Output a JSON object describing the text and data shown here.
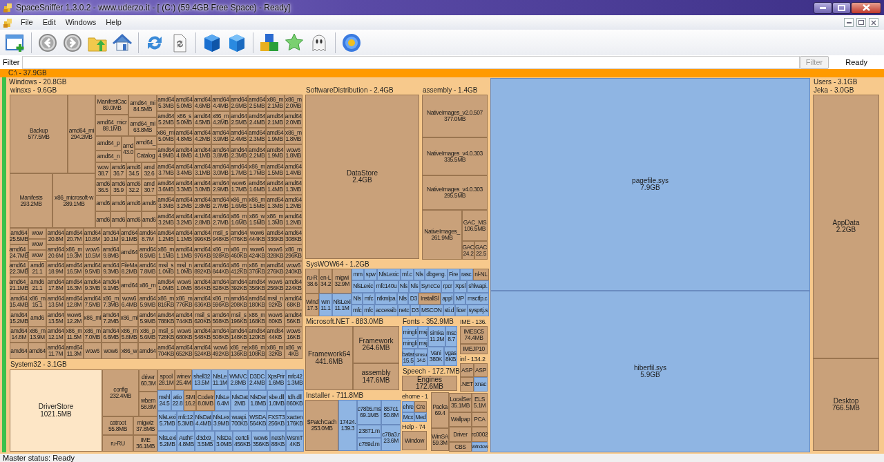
{
  "window": {
    "title": "SpaceSniffer 1.3.0.2 - www.uderzo.it - [ (C:) (59.4GB Free Space) - Ready]"
  },
  "menu": [
    "File",
    "Edit",
    "Windows",
    "Help"
  ],
  "filter": {
    "label": "Filter",
    "button": {
      "label": "Filter",
      "disabled": true
    },
    "status": "Ready"
  },
  "treemap": {
    "drive": "C:\\ - 37.9GB",
    "windows": {
      "label": "Windows - 20.8GB",
      "winsxs": {
        "label": "winsxs - 9.6GB",
        "kind": "folder",
        "large": [
          {
            "name": "Backup",
            "size": "577.5MB"
          },
          {
            "name": "amd64_mi",
            "size": "294.2MB"
          },
          {
            "name": "Manifests",
            "size": "293.2MB"
          },
          {
            "name": "x86_microsoft-w",
            "size": "289.1MB"
          }
        ],
        "small": [
          {
            "name": "ManifestCac",
            "size": "89.0MB"
          },
          {
            "name": "amd64_mi",
            "size": "84.5MB"
          },
          {
            "name": "amd64_micr",
            "size": "88.1MB"
          },
          {
            "name": "amd64_mi",
            "size": "63.8MB"
          },
          {
            "name": "amd64_p"
          },
          {
            "name": "amd",
            "size": "43.0"
          },
          {
            "name": "amd64_"
          },
          {
            "name": "amd64_n"
          },
          {
            "name": "Catalog"
          }
        ],
        "mid": [
          {
            "name": "wow",
            "size": "38.7"
          },
          {
            "name": "amd6",
            "size": "36.7"
          },
          {
            "name": "amd6",
            "size": "34.5"
          },
          {
            "name": "amd",
            "size": "32.6"
          },
          {
            "name": "amd6",
            "size": "36.5"
          },
          {
            "name": "amd6",
            "size": "35.9"
          },
          {
            "name": "amd6",
            "size": "32.2"
          },
          {
            "name": "amd",
            "size": "30.7"
          },
          {
            "name": "amd6"
          },
          {
            "name": "amd6"
          },
          {
            "name": "amd6"
          },
          {
            "name": "amd6"
          },
          {
            "name": "amd6"
          },
          {
            "name": "amd6"
          },
          {
            "name": "amd6"
          },
          {
            "name": "amd6"
          }
        ],
        "grid_top": [
          {
            "name": "amd64",
            "size": "5.3MB"
          },
          {
            "name": "amd64",
            "size": "5.0MB"
          },
          {
            "name": "amd64",
            "size": "4.6MB"
          },
          {
            "name": "amd64",
            "size": "4.4MB"
          },
          {
            "name": "amd64",
            "size": "2.6MB"
          },
          {
            "name": "amd64",
            "size": "2.5MB"
          },
          {
            "name": "x86_m",
            "size": "2.1MB"
          },
          {
            "name": "x86_m",
            "size": "2.0MB"
          },
          {
            "name": "amd64",
            "size": "5.2MB"
          },
          {
            "name": "x86_s",
            "size": "5.0MB"
          },
          {
            "name": "amd64",
            "size": "4.5MB"
          },
          {
            "name": "x86_m",
            "size": "4.2MB"
          },
          {
            "name": "amd64",
            "size": "2.5MB"
          },
          {
            "name": "amd64",
            "size": "2.4MB"
          },
          {
            "name": "amd64",
            "size": "2.1MB"
          },
          {
            "name": "amd64",
            "size": "2.0MB"
          },
          {
            "name": "x86_mi",
            "size": "5.0MB"
          },
          {
            "name": "amd64",
            "size": "4.8MB"
          },
          {
            "name": "amd64",
            "size": "4.2MB"
          },
          {
            "name": "amd64",
            "size": "3.9MB"
          },
          {
            "name": "amd64",
            "size": "2.4MB"
          },
          {
            "name": "amd64",
            "size": "2.3MB"
          },
          {
            "name": "amd64",
            "size": "1.9MB"
          },
          {
            "name": "x86_m",
            "size": "1.8MB"
          },
          {
            "name": "amd64",
            "size": "4.9MB"
          },
          {
            "name": "amd64",
            "size": "4.8MB"
          },
          {
            "name": "amd64",
            "size": "4.1MB"
          },
          {
            "name": "amd64",
            "size": "3.8MB"
          },
          {
            "name": "amd64",
            "size": "2.3MB"
          },
          {
            "name": "amd64",
            "size": "2.2MB"
          },
          {
            "name": "amd64",
            "size": "1.9MB"
          },
          {
            "name": "wow6",
            "size": "1.8MB"
          },
          {
            "name": "amd64",
            "size": "3.7MB"
          },
          {
            "name": "amd64",
            "size": "3.4MB"
          },
          {
            "name": "amd64",
            "size": "3.1MB"
          },
          {
            "name": "amd64",
            "size": "3.0MB"
          },
          {
            "name": "amd64",
            "size": "1.7MB"
          },
          {
            "name": "x86_m",
            "size": "1.7MB"
          },
          {
            "name": "amd64",
            "size": "1.5MB"
          },
          {
            "name": "amd64",
            "size": "1.4MB"
          },
          {
            "name": "amd64",
            "size": "3.6MB"
          },
          {
            "name": "amd64",
            "size": "3.3MB"
          },
          {
            "name": "amd64",
            "size": "3.0MB"
          },
          {
            "name": "amd64",
            "size": "2.9MB"
          },
          {
            "name": "wow6",
            "size": "1.7MB"
          },
          {
            "name": "amd64",
            "size": "1.6MB"
          },
          {
            "name": "amd64",
            "size": "1.4MB"
          },
          {
            "name": "amd64",
            "size": "1.3MB"
          },
          {
            "name": "amd64",
            "size": "3.3MB"
          },
          {
            "name": "amd64",
            "size": "3.2MB"
          },
          {
            "name": "amd64",
            "size": "2.8MB"
          },
          {
            "name": "amd64",
            "size": "2.7MB"
          },
          {
            "name": "x86_m",
            "size": "1.6MB"
          },
          {
            "name": "x86_m",
            "size": "1.5MB"
          },
          {
            "name": "amd64",
            "size": "1.3MB"
          },
          {
            "name": "amd64",
            "size": "1.2MB"
          },
          {
            "name": "amd64",
            "size": "3.2MB"
          },
          {
            "name": "amd64",
            "size": "3.2MB"
          },
          {
            "name": "amd64",
            "size": "2.8MB"
          },
          {
            "name": "amd64",
            "size": "2.7MB"
          },
          {
            "name": "x86_m",
            "size": "1.6MB"
          },
          {
            "name": "x86_w",
            "size": "1.5MB"
          },
          {
            "name": "x86_m",
            "size": "1.3MB"
          },
          {
            "name": "amd64",
            "size": "1.2MB"
          }
        ],
        "left_bottom": [
          {
            "name": "amd64",
            "size": "25.5MB"
          },
          {
            "stack": [
              {
                "name": "wow"
              },
              {
                "name": "wow"
              },
              {
                "name": "wow"
              }
            ]
          },
          {
            "name": "amd64",
            "size": "20.8M"
          },
          {
            "name": "amd64",
            "size": "20.7M"
          },
          {
            "name": "amd64",
            "size": "10.8M"
          },
          {
            "name": "amd64",
            "size": "10.1M"
          },
          {
            "name": "amd64",
            "size": "9.1MB"
          },
          {
            "name": "amd64",
            "size": "8.7M"
          },
          {
            "name": "amd64_",
            "size": "24.7MB"
          },
          {
            "name": "amd64",
            "size": "20.6M"
          },
          {
            "name": "x86_m",
            "size": "19.3M"
          },
          {
            "name": "wow6",
            "size": "10.5M"
          },
          {
            "name": "amd64",
            "size": "9.8MB"
          },
          {
            "name": "amd64"
          },
          {
            "name": "amd64",
            "size": "8.5MB"
          },
          {
            "name": "amd64_",
            "size": "22.3MB"
          },
          {
            "name": "amd6",
            "size": "21.1"
          },
          {
            "name": "amd64",
            "size": "18.9M"
          },
          {
            "name": "amd64",
            "size": "16.5M"
          },
          {
            "name": "amd64",
            "size": "9.5MB"
          },
          {
            "name": "amd64",
            "size": "9.3MB"
          },
          {
            "name": "FileMa",
            "size": "8.2MB"
          },
          {
            "name": "amd64",
            "size": "7.8MB"
          },
          {
            "name": "amd64_",
            "size": "21.1MB"
          },
          {
            "name": "amd6",
            "size": "21.1"
          },
          {
            "name": "amd64",
            "size": "17.8M"
          },
          {
            "name": "amd64",
            "size": "16.3M"
          },
          {
            "name": "amd64",
            "size": "9.3MB"
          },
          {
            "name": "amd64",
            "size": "9.1MB"
          },
          {
            "name": "amd64"
          },
          {
            "name": "x86_m"
          },
          {
            "name": "amd64",
            "size": "15.4MB"
          },
          {
            "name": "x86_m",
            "size": "15.1"
          },
          {
            "name": "amd64",
            "size": "13.5M"
          },
          {
            "name": "amd64",
            "size": "12.8M"
          },
          {
            "name": "amd64",
            "size": "7.5MB"
          },
          {
            "name": "x86_m",
            "size": "7.3MB"
          },
          {
            "name": "wow6",
            "size": "6.4MB"
          },
          {
            "name": "amd64",
            "size": "5.9MB"
          },
          {
            "name": "amd64",
            "size": "15.2MB"
          },
          {
            "name": "amd6"
          },
          {
            "name": "amd64",
            "size": "13.5M"
          },
          {
            "name": "wow6",
            "size": "12.2M"
          },
          {
            "name": "x86_mi"
          },
          {
            "name": "amd64",
            "size": "7.2MB"
          },
          {
            "name": "x86_mi"
          },
          {
            "name": "amd64",
            "size": "5.9MB"
          },
          {
            "name": "amd64",
            "size": "14.8M"
          },
          {
            "name": "x86_m",
            "size": "13.9M"
          },
          {
            "name": "amd64",
            "size": "12.1M"
          },
          {
            "name": "x86_m",
            "size": "11.5M"
          },
          {
            "name": "x86_m",
            "size": "7.0MB"
          },
          {
            "name": "amd64",
            "size": "6.6MB"
          },
          {
            "name": "x86_m",
            "size": "5.8MB"
          },
          {
            "name": "x86_p",
            "size": "5.6MB"
          },
          {
            "name": "amd64"
          },
          {
            "name": "amd64"
          },
          {
            "name": "amd64",
            "size": "11.7M"
          },
          {
            "name": "amd64",
            "size": "11.3M"
          },
          {
            "name": "wow6"
          },
          {
            "name": "wow6"
          },
          {
            "name": "x86_w"
          },
          {
            "name": "amd64"
          }
        ],
        "grid_bottom": [
          {
            "name": "amd64",
            "size": "1.2MB"
          },
          {
            "name": "amd64",
            "size": "1.1MB"
          },
          {
            "name": "amd64",
            "size": "996KB"
          },
          {
            "name": "msil_s",
            "size": "948KB"
          },
          {
            "name": "amd64",
            "size": "476KB"
          },
          {
            "name": "wow6",
            "size": "444KB"
          },
          {
            "name": "amd64",
            "size": "336KB"
          },
          {
            "name": "amd64",
            "size": "308KB"
          },
          {
            "name": "x86_m",
            "size": "1.1MB"
          },
          {
            "name": "amd64",
            "size": "1.1MB"
          },
          {
            "name": "amd64",
            "size": "976KB"
          },
          {
            "name": "x86_m",
            "size": "928KB"
          },
          {
            "name": "x86_m",
            "size": "460KB"
          },
          {
            "name": "wow6",
            "size": "424KB"
          },
          {
            "name": "wow6",
            "size": "328KB"
          },
          {
            "name": "x86_m",
            "size": "296KB"
          },
          {
            "name": "msil_s",
            "size": "1.0MB"
          },
          {
            "name": "msil_n",
            "size": "1.0MB"
          },
          {
            "name": "amd64",
            "size": "892KB"
          },
          {
            "name": "amd64",
            "size": "844KB"
          },
          {
            "name": "x86_m",
            "size": "412KB"
          },
          {
            "name": "x86_m",
            "size": "376KB"
          },
          {
            "name": "amd64",
            "size": "276KB"
          },
          {
            "name": "wow6",
            "size": "240KB"
          },
          {
            "name": "amd64",
            "size": "1.0MB"
          },
          {
            "name": "wow6",
            "size": "1.0MB"
          },
          {
            "name": "amd64",
            "size": "864KB"
          },
          {
            "name": "amd64",
            "size": "828KB"
          },
          {
            "name": "amd64",
            "size": "392KB"
          },
          {
            "name": "amd64",
            "size": "356KB"
          },
          {
            "name": "wow6",
            "size": "256KB"
          },
          {
            "name": "amd64",
            "size": "224KB"
          },
          {
            "name": "x86_m",
            "size": "816KB"
          },
          {
            "name": "x86_m",
            "size": "776KB"
          },
          {
            "name": "amd64",
            "size": "636KB"
          },
          {
            "name": "x86_m",
            "size": "596KB"
          },
          {
            "name": "amd64",
            "size": "208KB"
          },
          {
            "name": "amd64",
            "size": "180KB"
          },
          {
            "name": "msil_n",
            "size": "92KB"
          },
          {
            "name": "amd64",
            "size": "68KB"
          },
          {
            "name": "amd64",
            "size": "788KB"
          },
          {
            "name": "amd64",
            "size": "744KB"
          },
          {
            "name": "msil_s",
            "size": "620KB"
          },
          {
            "name": "amd64",
            "size": "568KB"
          },
          {
            "name": "msil_s",
            "size": "196KB"
          },
          {
            "name": "x86_m",
            "size": "168KB"
          },
          {
            "name": "wow6",
            "size": "80KB"
          },
          {
            "name": "amd64",
            "size": "56KB"
          },
          {
            "name": "msil_s",
            "size": "728KB"
          },
          {
            "name": "wow6",
            "size": "680KB"
          },
          {
            "name": "amd64",
            "size": "548KB"
          },
          {
            "name": "amd64",
            "size": "508KB"
          },
          {
            "name": "amd64",
            "size": "148KB"
          },
          {
            "name": "amd64",
            "size": "120KB"
          },
          {
            "name": "amd64",
            "size": "44KB"
          },
          {
            "name": "wow6",
            "size": "16KB"
          },
          {
            "name": "amd64",
            "size": "704KB"
          },
          {
            "name": "amd64",
            "size": "652KB"
          },
          {
            "name": "amd64",
            "size": "524KB"
          },
          {
            "name": "wow6",
            "size": "492KB"
          },
          {
            "name": "x86_ne",
            "size": "136KB"
          },
          {
            "name": "x86_m",
            "size": "108KB"
          },
          {
            "name": "x86_m",
            "size": "32KB"
          },
          {
            "name": "x86_w",
            "size": "4KB"
          }
        ]
      },
      "software_distribution": {
        "label": "SoftwareDistribution - 2.4GB",
        "tiles": [
          {
            "name": "DataStore",
            "size": "2.4GB",
            "kind": "folder"
          }
        ]
      },
      "assembly": {
        "label": "assembly - 1.4GB",
        "tiles": [
          {
            "name": "NativeImages_v2.0.507",
            "size": "377.0MB",
            "kind": "folder"
          },
          {
            "name": "NativeImages_v4.0.303",
            "size": "335.5MB",
            "kind": "folder"
          },
          {
            "name": "NativeImages_v4.0.303",
            "size": "295.5MB",
            "kind": "folder"
          },
          {
            "name": "NativeImages_",
            "size": "261.9MB",
            "kind": "folder"
          },
          {
            "name": "GAC_MS",
            "size": "106.5MB",
            "kind": "folder"
          },
          {
            "name": "GAC",
            "size": "24.2",
            "kind": "folder"
          },
          {
            "name": "GAC",
            "size": "22.5",
            "kind": "folder"
          }
        ]
      },
      "syswow64": {
        "label": "SysWOW64 - 1.2GB",
        "tiles": [
          {
            "name": "ru-R",
            "size": "38.6",
            "kind": "folder"
          },
          {
            "name": "en-L",
            "size": "34.2",
            "kind": "folder"
          },
          {
            "name": "migwi",
            "size": "32.9M",
            "kind": "folder"
          },
          {
            "name": "Wind",
            "size": "17.3",
            "kind": "folder"
          },
          {
            "name": "wm",
            "size": "11.1",
            "kind": "file"
          },
          {
            "name": "NlsLexi",
            "size": "11.1M",
            "kind": "file"
          }
        ],
        "rows": [
          {
            "tiles": [
              {
                "name": "mm",
                "kind": "file"
              },
              {
                "name": "spw",
                "kind": "file"
              },
              {
                "name": "NlsLexic",
                "kind": "file"
              },
              {
                "name": "mf.c",
                "kind": "file"
              },
              {
                "name": "Nls",
                "kind": "file"
              },
              {
                "name": "dbgeng.",
                "kind": "file"
              },
              {
                "name": "Fire",
                "kind": "file"
              },
              {
                "name": "rasc",
                "kind": "file"
              },
              {
                "name": "nl-NL",
                "kind": "folder"
              }
            ]
          },
          {
            "tiles": [
              {
                "name": "NlsLexic",
                "kind": "file"
              },
              {
                "name": "mfc140u",
                "kind": "file"
              },
              {
                "name": "Nls",
                "kind": "file"
              },
              {
                "name": "Nls",
                "kind": "file"
              },
              {
                "name": "SyncCe",
                "kind": "file"
              },
              {
                "name": "rpcr",
                "kind": "file"
              },
              {
                "name": "Xpsl",
                "kind": "file"
              },
              {
                "name": "shlwapi.",
                "kind": "file"
              }
            ]
          },
          {
            "tiles": [
              {
                "name": "Nls",
                "kind": "file"
              },
              {
                "name": "mfc",
                "kind": "file"
              },
              {
                "name": "ntkmlpa",
                "kind": "file"
              },
              {
                "name": "Nls",
                "kind": "file"
              },
              {
                "name": "D3",
                "kind": "file"
              },
              {
                "name": "InstallSl",
                "kind": "folder"
              },
              {
                "name": "appl",
                "kind": "file"
              },
              {
                "name": "MP",
                "kind": "file"
              },
              {
                "name": "msctfp.c",
                "kind": "file"
              }
            ]
          },
          {
            "tiles": [
              {
                "name": "mfc",
                "kind": "file"
              },
              {
                "name": "mfc",
                "kind": "file"
              },
              {
                "name": "accessib",
                "kind": "file"
              },
              {
                "name": "netc",
                "kind": "file"
              },
              {
                "name": "D3",
                "kind": "file"
              },
              {
                "name": "MSCON",
                "kind": "file"
              },
              {
                "name": "sti.d",
                "kind": "file"
              },
              {
                "name": "licer",
                "kind": "file"
              },
              {
                "name": "sysprtj.s",
                "kind": "file"
              }
            ]
          }
        ]
      },
      "system32": {
        "label": "System32 - 3.1GB",
        "driver_store": {
          "name": "DriverStore",
          "size": "1021.5MB",
          "highlighted": true
        },
        "tiles": [
          {
            "name": "config",
            "size": "232.4MB",
            "kind": "folder"
          },
          {
            "name": "catroot",
            "size": "55.8MB",
            "kind": "folder"
          },
          {
            "name": "ru-RU",
            "kind": "folder"
          },
          {
            "name": "driver",
            "size": "60.3M",
            "kind": "folder"
          },
          {
            "name": "wbem",
            "size": "58.8M",
            "kind": "folder"
          },
          {
            "name": "migwiz",
            "size": "37.8MB",
            "kind": "folder"
          },
          {
            "name": "IME",
            "size": "36.1MB",
            "kind": "folder"
          }
        ],
        "rows": [
          {
            "tiles": [
              {
                "name": "spool",
                "size": "28.1M",
                "kind": "folder"
              },
              {
                "name": "winev",
                "size": "25.4M",
                "kind": "folder"
              },
              {
                "name": "shell32",
                "size": "13.5M",
                "kind": "file"
              },
              {
                "name": "NlsLe",
                "size": "11.1M",
                "kind": "file"
              },
              {
                "name": "WMVC",
                "size": "2.8MB",
                "kind": "file"
              },
              {
                "name": "D3DC",
                "size": "2.4MB",
                "kind": "file"
              },
              {
                "name": "XpsPrir",
                "size": "1.6MB",
                "kind": "file"
              },
              {
                "name": "mfc42",
                "size": "1.3MB",
                "kind": "file"
              }
            ]
          },
          {
            "tiles": [
              {
                "name": "mshl",
                "size": "24.5",
                "kind": "file"
              },
              {
                "name": "atio",
                "size": "22.8",
                "kind": "file"
              },
              {
                "name": "SMI",
                "size": "16.2",
                "kind": "folder"
              },
              {
                "name": "CodeIr",
                "size": "8.0MB",
                "kind": "folder"
              },
              {
                "name": "NlsLe",
                "size": "6.4M",
                "kind": "file"
              },
              {
                "name": "NlsDat",
                "size": "2MB",
                "kind": "file"
              },
              {
                "name": "NlsDar",
                "size": "1.8MB",
                "kind": "file"
              },
              {
                "name": "sbe.dll",
                "size": "1.0MB",
                "kind": "file"
              },
              {
                "name": "tdh.dll",
                "size": "860KB",
                "kind": "file"
              }
            ]
          },
          {
            "tiles": [
              {
                "name": "NlsLexi",
                "size": "5.7MB",
                "kind": "file"
              },
              {
                "name": "mfc12",
                "size": "5.3MB",
                "kind": "file"
              },
              {
                "name": "NlsDat",
                "size": "4.4MB",
                "kind": "file"
              },
              {
                "name": "NlsLex",
                "size": "3.9MB",
                "kind": "file"
              },
              {
                "name": "wuapi.",
                "size": "700KB",
                "kind": "file"
              },
              {
                "name": "WSDA",
                "size": "564KB",
                "kind": "file"
              },
              {
                "name": "FXST3",
                "size": "256KB",
                "kind": "file"
              },
              {
                "name": "xacten",
                "size": "176KB",
                "kind": "file"
              }
            ]
          },
          {
            "tiles": [
              {
                "name": "NlsLexi",
                "size": "5.2MB",
                "kind": "file"
              },
              {
                "name": "AuthF",
                "size": "4.8MB",
                "kind": "file"
              },
              {
                "name": "d3dx9_",
                "size": "3.5MB",
                "kind": "file"
              },
              {
                "name": "NlsDa",
                "size": "3.0MB",
                "kind": "file"
              },
              {
                "name": "certcli",
                "size": "456KB",
                "kind": "file"
              },
              {
                "name": "wow6",
                "size": "356KB",
                "kind": "file"
              },
              {
                "name": "netsh",
                "size": "88KB",
                "kind": "file"
              },
              {
                "name": "WsmT",
                "size": "4KB",
                "kind": "file"
              }
            ]
          }
        ]
      },
      "dotnet": {
        "label": "Microsoft.NET - 883.0MB",
        "tiles": [
          {
            "name": "Framework64",
            "size": "441.6MB",
            "kind": "folder"
          },
          {
            "name": "Framework",
            "size": "264.6MB",
            "kind": "folder"
          },
          {
            "name": "assembly",
            "size": "147.6MB",
            "kind": "folder"
          }
        ]
      },
      "fonts": {
        "label": "Fonts - 352.9MB",
        "tiles": [
          {
            "name": "mingli",
            "kind": "file"
          },
          {
            "name": "msj",
            "kind": "file"
          },
          {
            "name": "simka",
            "size": "11.2M",
            "kind": "file"
          },
          {
            "name": "msc",
            "size": "8.7",
            "kind": "file"
          },
          {
            "name": "mingli",
            "kind": "file"
          },
          {
            "name": "msj",
            "kind": "file"
          },
          {
            "name": "batar",
            "size": "15.5",
            "kind": "file"
          },
          {
            "name": "simsu",
            "size": "14.6",
            "kind": "file"
          },
          {
            "name": "Vani",
            "size": "380K",
            "kind": "file"
          },
          {
            "name": "vgas",
            "size": "8KB",
            "kind": "file"
          }
        ]
      },
      "ime": {
        "label": "IME - 136.",
        "tiles": [
          {
            "name": "IMESC5",
            "size": "74.4MB",
            "kind": "folder"
          },
          {
            "name": "IMEJP10",
            "kind": "folder"
          }
        ]
      },
      "inf": {
        "label": "inf - 134.2",
        "tiles": [
          {
            "name": "ASP",
            "kind": "folder"
          },
          {
            "name": "ASP",
            "kind": "folder"
          },
          {
            "name": ".NET",
            "kind": "folder"
          },
          {
            "name": "xnac",
            "kind": "file"
          }
        ]
      },
      "speech": {
        "label": "Speech - 172.7MB",
        "tiles": [
          {
            "name": "Engines",
            "size": "172.6MB",
            "kind": "folder"
          }
        ]
      },
      "installer": {
        "label": "Installer - 711.8MB",
        "tiles": [
          {
            "name": "$PatchCach",
            "size": "253.0MB",
            "kind": "folder"
          },
          {
            "name": "17424.",
            "size": "139.3",
            "kind": "file"
          },
          {
            "name": "c78b5.ms",
            "size": "69.1MB",
            "kind": "file"
          },
          {
            "name": "857c1",
            "size": "50.8M",
            "kind": "file"
          },
          {
            "name": "23871.m",
            "kind": "file"
          },
          {
            "name": "c78a3.r",
            "size": "23.6M",
            "kind": "file"
          },
          {
            "name": "c789d.m",
            "kind": "file"
          }
        ]
      },
      "ehome": {
        "label": "ehome - 1",
        "tiles": [
          {
            "name": "ehre",
            "kind": "file"
          },
          {
            "name": "Cre",
            "kind": "folder"
          },
          {
            "name": "Mcx",
            "kind": "file"
          },
          {
            "name": "Med",
            "kind": "file"
          }
        ]
      },
      "help": {
        "label": "Help - 74",
        "tiles": [
          {
            "name": "Window",
            "kind": "folder"
          }
        ]
      },
      "misc": [
        {
          "name": "Packa",
          "size": "69.4",
          "kind": "folder"
        },
        {
          "name": "WinSA",
          "size": "59.3M",
          "kind": "folder"
        },
        {
          "name": "LocalSer",
          "size": "35.1MB",
          "kind": "folder"
        },
        {
          "name": "ELS",
          "size": "5.1M",
          "kind": "folder"
        },
        {
          "name": "Wallpap",
          "kind": "folder"
        },
        {
          "name": "PCA",
          "kind": "folder"
        },
        {
          "name": "Driver",
          "kind": "folder"
        },
        {
          "name": "rc0002",
          "kind": "folder"
        },
        {
          "name": "CBS",
          "kind": "folder"
        },
        {
          "name": "Window",
          "kind": "file"
        }
      ]
    },
    "files": [
      {
        "name": "pagefile.sys",
        "size": "7.9GB",
        "kind": "file"
      },
      {
        "name": "hiberfil.sys",
        "size": "5.9GB",
        "kind": "file"
      }
    ],
    "users": {
      "label": "Users - 3.1GB",
      "jeka": {
        "label": "Jeka - 3.0GB",
        "tiles": [
          {
            "name": "AppData",
            "size": "2.2GB",
            "kind": "folder"
          },
          {
            "name": "Desktop",
            "size": "766.5MB",
            "kind": "folder"
          }
        ]
      }
    }
  },
  "status_bar": "Master status: Ready"
}
